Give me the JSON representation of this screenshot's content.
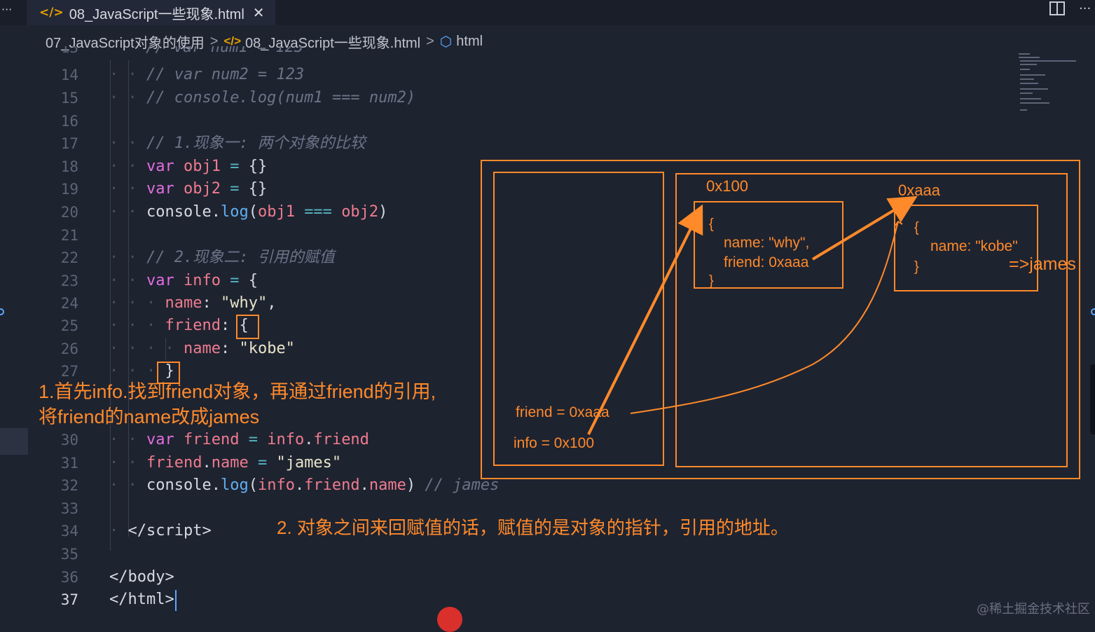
{
  "tab": {
    "filename": "08_JavaScript一些现象.html",
    "code_icon": "</>",
    "close_glyph": "✕"
  },
  "window": {
    "more_glyph": "···"
  },
  "breadcrumb": {
    "folder": "07_JavaScript对象的使用",
    "file": "08_JavaScript一些现象.html",
    "node": "html",
    "sep": ">"
  },
  "editor": {
    "partial_line": "// var num1 = 123",
    "lines": [
      {
        "n": "14"
      },
      {
        "n": "15"
      },
      {
        "n": "16"
      },
      {
        "n": "17"
      },
      {
        "n": "18"
      },
      {
        "n": "19"
      },
      {
        "n": "20"
      },
      {
        "n": "21"
      },
      {
        "n": "22"
      },
      {
        "n": "23"
      },
      {
        "n": "24"
      },
      {
        "n": "25"
      },
      {
        "n": "26"
      },
      {
        "n": "27"
      },
      {
        "n": "30"
      },
      {
        "n": "31"
      },
      {
        "n": "32"
      },
      {
        "n": "33"
      },
      {
        "n": "34"
      },
      {
        "n": "35"
      },
      {
        "n": "36"
      },
      {
        "n": "37"
      }
    ],
    "code": {
      "l14": "// var num2 = 123",
      "l15": "// console.log(num1 === num2)",
      "l17": "// 1.现象一: 两个对象的比较",
      "l22": "// 2.现象二: 引用的赋值",
      "l32_comment": "// james"
    }
  },
  "annotations": {
    "note1_line1": "1.首先info.找到friend对象，再通过friend的引用,",
    "note1_line2": "将friend的name改成james",
    "note2": "2. 对象之间来回赋值的话，赋值的是对象的指针，引用的地址。"
  },
  "diagram": {
    "addr1": "0x100",
    "addr2": "0xaaa",
    "obj1_open": "{",
    "obj1_name": "name: \"why\",",
    "obj1_friend": "friend: 0xaaa",
    "obj1_close": "}",
    "obj2_open": "{",
    "obj2_name": "name: \"kobe\"",
    "obj2_close": "}",
    "obj2_change": "=>james",
    "stack_friend": "friend = 0xaaa",
    "stack_info": "info = 0x100",
    "accent_color": "#ff8a2a"
  },
  "watermark": "@稀土掘金技术社区"
}
